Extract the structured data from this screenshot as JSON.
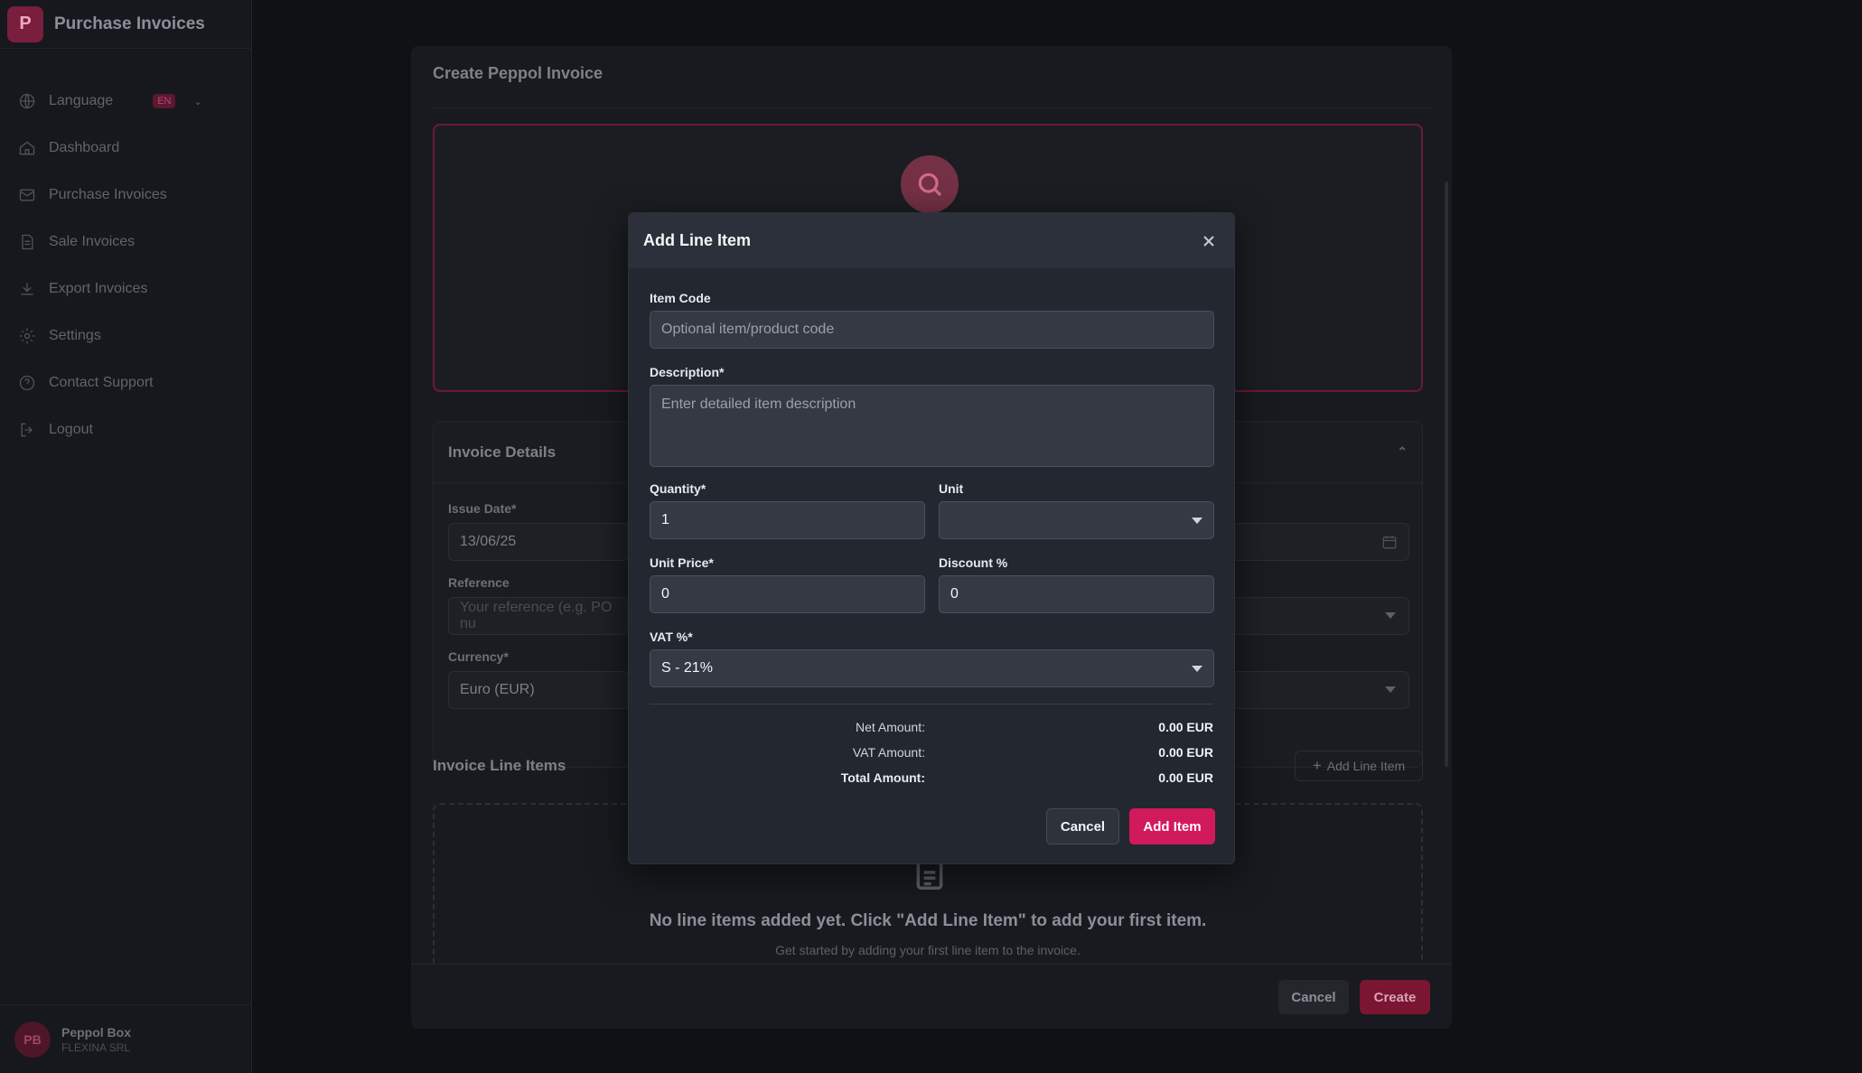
{
  "sidebar": {
    "logo_letter": "P",
    "title": "Purchase Invoices",
    "items": [
      {
        "label": "Language",
        "icon": "globe-icon"
      },
      {
        "label": "Dashboard",
        "icon": "home-icon"
      },
      {
        "label": "Purchase Invoices",
        "icon": "mail-icon"
      },
      {
        "label": "Sale Invoices",
        "icon": "document-icon"
      },
      {
        "label": "Export Invoices",
        "icon": "download-icon"
      },
      {
        "label": "Settings",
        "icon": "gear-icon"
      },
      {
        "label": "Contact Support",
        "icon": "help-icon"
      },
      {
        "label": "Logout",
        "icon": "logout-icon"
      }
    ],
    "language_badge": "EN",
    "user": {
      "initials": "PB",
      "name": "Peppol Box",
      "org": "FLEXINA SRL"
    }
  },
  "panel": {
    "title": "Create Peppol Invoice",
    "details_title": "Invoice Details",
    "issue_date_label": "Issue Date*",
    "issue_date_value": "13/06/25",
    "reference_label": "Reference",
    "reference_placeholder": "Your reference (e.g. PO nu",
    "currency_label": "Currency*",
    "currency_value": "Euro (EUR)",
    "line_items_title": "Invoice Line Items",
    "add_line_item_label": "Add Line Item",
    "empty_title": "No line items added yet. Click \"Add Line Item\" to add your first item.",
    "empty_subtitle": "Get started by adding your first line item to the invoice.",
    "cancel_label": "Cancel",
    "create_label": "Create"
  },
  "modal": {
    "title": "Add Line Item",
    "item_code_label": "Item Code",
    "item_code_placeholder": "Optional item/product code",
    "description_label": "Description*",
    "description_placeholder": "Enter detailed item description",
    "quantity_label": "Quantity*",
    "quantity_value": "1",
    "unit_label": "Unit",
    "unit_value": "",
    "unit_price_label": "Unit Price*",
    "unit_price_value": "0",
    "discount_label": "Discount %",
    "discount_value": "0",
    "vat_label": "VAT %*",
    "vat_value": "S - 21%",
    "net_amount_label": "Net Amount:",
    "net_amount_value": "0.00 EUR",
    "vat_amount_label": "VAT Amount:",
    "vat_amount_value": "0.00 EUR",
    "total_amount_label": "Total Amount:",
    "total_amount_value": "0.00 EUR",
    "cancel_label": "Cancel",
    "add_label": "Add Item"
  },
  "colors": {
    "accent": "#d11a5b",
    "background": "#0f1115",
    "modal": "#232730"
  }
}
